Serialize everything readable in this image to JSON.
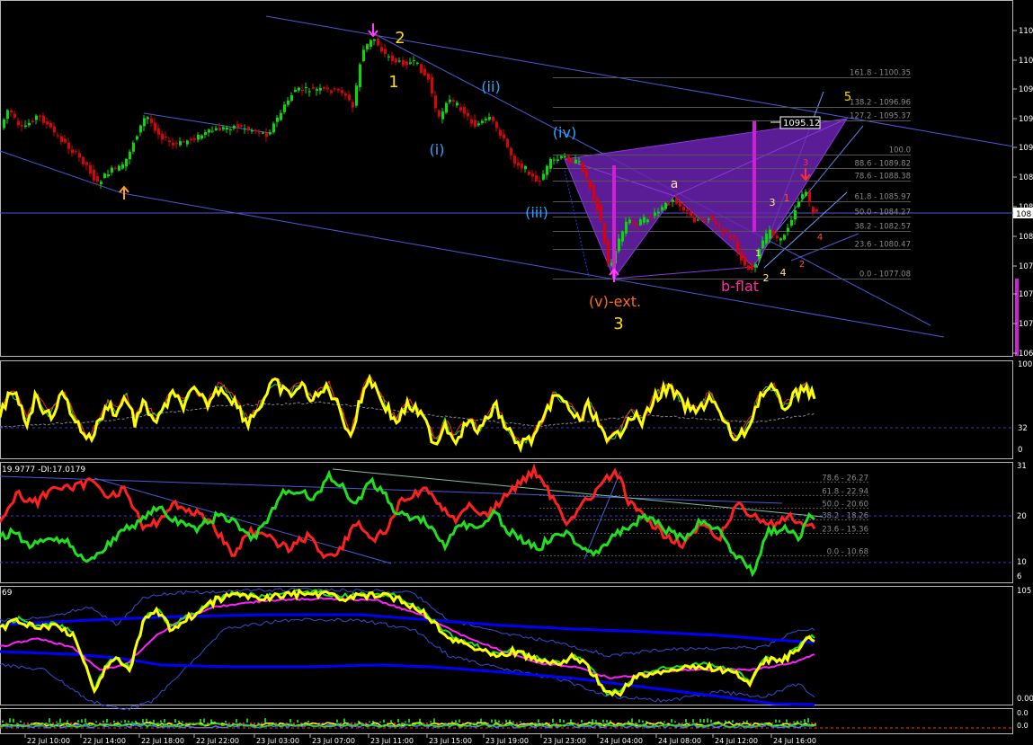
{
  "colors": {
    "background": "#000000",
    "candle_up": "#00e000",
    "candle_down": "#e00000",
    "channel": "#4a5bd6",
    "pattern_fill": "#6a22b0",
    "wave_yellow": "#ffdd00",
    "wave_cyan": "#2aa7ff",
    "wave_orange": "#ff6a1a",
    "wave_magenta": "#ff2fa0",
    "marker_magenta": "#d21ed6",
    "fib_text": "#8a8a8a",
    "stoch_main": "#ffff00",
    "stoch_red": "#ff2020",
    "stoch_green": "#20e020",
    "plus_di": "#20e020",
    "minus_di": "#ff2020",
    "rsi_yellow": "#ffff00",
    "rsi_green": "#20e020",
    "rsi_magenta": "#ff20ff",
    "band_blue": "#0000ff",
    "band_thin": "#3a4ad6",
    "axis_text": "#ffffff"
  },
  "chart_data": [
    {
      "type": "candlestick",
      "panel": "price",
      "price_label": "1095.12",
      "y_ticks": [
        "110",
        "110",
        "109",
        "109",
        "109",
        "108",
        "108",
        "108",
        "107",
        "107",
        "107",
        "106"
      ],
      "current_price_tag": "108",
      "fib_levels": [
        {
          "label": "161.8 - 1100.35",
          "value": 1100.35
        },
        {
          "label": "138.2 - 1096.96",
          "value": 1096.96
        },
        {
          "label": "127.2 - 1095.37",
          "value": 1095.37
        },
        {
          "label": "100.0",
          "value": 1091.46
        },
        {
          "label": "88.6 - 1089.82",
          "value": 1089.82
        },
        {
          "label": "78.6 - 1088.38",
          "value": 1088.38
        },
        {
          "label": "61.8 - 1085.97",
          "value": 1085.97
        },
        {
          "label": "50.0 - 1084.27",
          "value": 1084.27
        },
        {
          "label": "38.2 - 1082.57",
          "value": 1082.57
        },
        {
          "label": "23.6 - 1080.47",
          "value": 1080.47
        },
        {
          "label": "0.0 - 1077.08",
          "value": 1077.08
        }
      ],
      "wave_labels": [
        {
          "text": "2",
          "color": "wave_yellow"
        },
        {
          "text": "1",
          "color": "wave_yellow"
        },
        {
          "text": "(ii)",
          "color": "wave_cyan"
        },
        {
          "text": "(i)",
          "color": "wave_cyan"
        },
        {
          "text": "(iv)",
          "color": "wave_cyan"
        },
        {
          "text": "(iii)",
          "color": "wave_cyan"
        },
        {
          "text": "a",
          "color": "#ffe0b0"
        },
        {
          "text": "(v)-ext.",
          "color": "wave_orange"
        },
        {
          "text": "3",
          "color": "wave_yellow"
        },
        {
          "text": "b-flat",
          "color": "wave_magenta"
        },
        {
          "text": "5",
          "color": "wave_yellow"
        },
        {
          "text": "3",
          "color": "#ff3030"
        },
        {
          "text": "3",
          "color": "#ffee80"
        },
        {
          "text": "1",
          "color": "#ff5030"
        },
        {
          "text": "2",
          "color": "#ffee80"
        },
        {
          "text": "4",
          "color": "#ffee80"
        },
        {
          "text": "2",
          "color": "#ff5030"
        },
        {
          "text": "4",
          "color": "#ff5030"
        },
        {
          "text": "1",
          "color": "#ffee80"
        }
      ],
      "x_ticks": [
        "22 Jul 10:00",
        "22 Jul 14:00",
        "22 Jul 18:00",
        "22 Jul 22:00",
        "23 Jul 03:00",
        "23 Jul 07:00",
        "23 Jul 11:00",
        "23 Jul 15:00",
        "23 Jul 19:00",
        "23 Jul 23:00",
        "24 Jul 04:00",
        "24 Jul 08:00",
        "24 Jul 12:00",
        "24 Jul 16:00"
      ]
    },
    {
      "type": "line",
      "panel": "stochastic",
      "y_ticks": [
        "100",
        "32",
        "0"
      ]
    },
    {
      "type": "line",
      "panel": "dmi",
      "title": "19.9777 -DI:17.0179",
      "y_ticks": [
        "31",
        "20",
        "10",
        "6"
      ],
      "fib_levels": [
        {
          "label": "78.6 - 26.27",
          "value": 26.27
        },
        {
          "label": "61.8 - 22.94",
          "value": 22.94
        },
        {
          "label": "50.0 - 20.60",
          "value": 20.6
        },
        {
          "label": "38.2 - 18.26",
          "value": 18.26
        },
        {
          "label": "23.6 - 15.36",
          "value": 15.36
        },
        {
          "label": "0.0 - 10.68",
          "value": 10.68
        }
      ]
    },
    {
      "type": "line",
      "panel": "rsi_bands",
      "title": "69",
      "y_ticks": [
        "105",
        "0.00"
      ]
    },
    {
      "type": "bar",
      "panel": "histogram",
      "y_ticks": [
        "0.0",
        "0.0"
      ]
    }
  ]
}
